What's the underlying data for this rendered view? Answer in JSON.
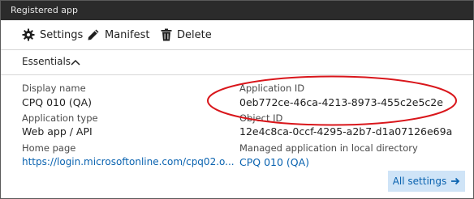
{
  "window": {
    "title": "Registered app"
  },
  "toolbar": {
    "settings_label": "Settings",
    "manifest_label": "Manifest",
    "delete_label": "Delete"
  },
  "essentials": {
    "label": "Essentials"
  },
  "fields": {
    "display_name": {
      "label": "Display name",
      "value": "CPQ 010 (QA)"
    },
    "application_type": {
      "label": "Application type",
      "value": "Web app / API"
    },
    "home_page": {
      "label": "Home page",
      "value": "https://login.microsoftonline.com/cpq02.o..."
    },
    "application_id": {
      "label": "Application ID",
      "value": "0eb772ce-46ca-4213-8973-455c2e5c2e"
    },
    "object_id": {
      "label": "Object ID",
      "value": "12e4c8ca-0ccf-4295-a2b7-d1a07126e69a"
    },
    "managed_app": {
      "label": "Managed application in local directory",
      "value": "CPQ 010 (QA)"
    }
  },
  "all_settings": {
    "label": "All settings"
  },
  "colors": {
    "title_bg": "#2b2b2b",
    "link": "#0a63b0",
    "highlight_ellipse": "#d9161b",
    "button_bg": "#cfe4f7"
  },
  "icons": [
    "gear-icon",
    "pencil-icon",
    "trash-icon",
    "chevron-up-icon",
    "arrow-right-icon"
  ]
}
